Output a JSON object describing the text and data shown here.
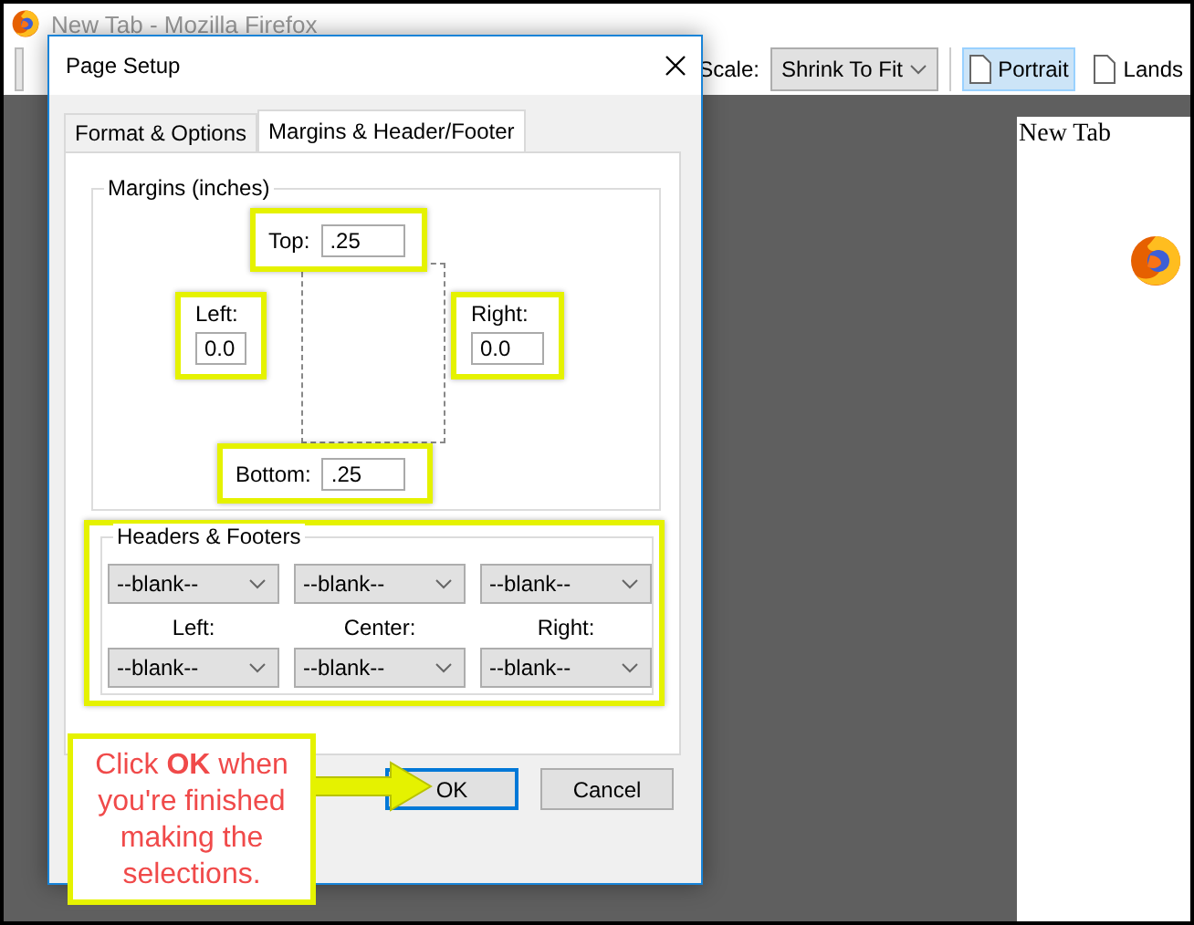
{
  "window": {
    "title": "New Tab - Mozilla Firefox"
  },
  "toolbar": {
    "scale_label": "Scale:",
    "scale_value": "Shrink To Fit",
    "orientations": [
      {
        "label": "Portrait",
        "selected": true
      },
      {
        "label": "Lands",
        "selected": false
      }
    ]
  },
  "preview": {
    "page_title": "New Tab"
  },
  "dialog": {
    "title": "Page Setup",
    "tabs": [
      {
        "label": "Format & Options",
        "selected": false
      },
      {
        "label": "Margins & Header/Footer",
        "selected": true
      }
    ],
    "margins": {
      "title": "Margins (inches)",
      "top": {
        "label": "Top:",
        "value": ".25"
      },
      "left": {
        "label": "Left:",
        "value": "0.0"
      },
      "right": {
        "label": "Right:",
        "value": "0.0"
      },
      "bottom": {
        "label": "Bottom:",
        "value": ".25"
      }
    },
    "headers_footers": {
      "title": "Headers & Footers",
      "headers": [
        "--blank--",
        "--blank--",
        "--blank--"
      ],
      "column_labels": [
        "Left:",
        "Center:",
        "Right:"
      ],
      "footers": [
        "--blank--",
        "--blank--",
        "--blank--"
      ]
    },
    "buttons": [
      {
        "label": "OK",
        "default": true
      },
      {
        "label": "Cancel",
        "default": false
      }
    ]
  },
  "callout": {
    "text": "Click **OK** when you're finished making the selections."
  }
}
